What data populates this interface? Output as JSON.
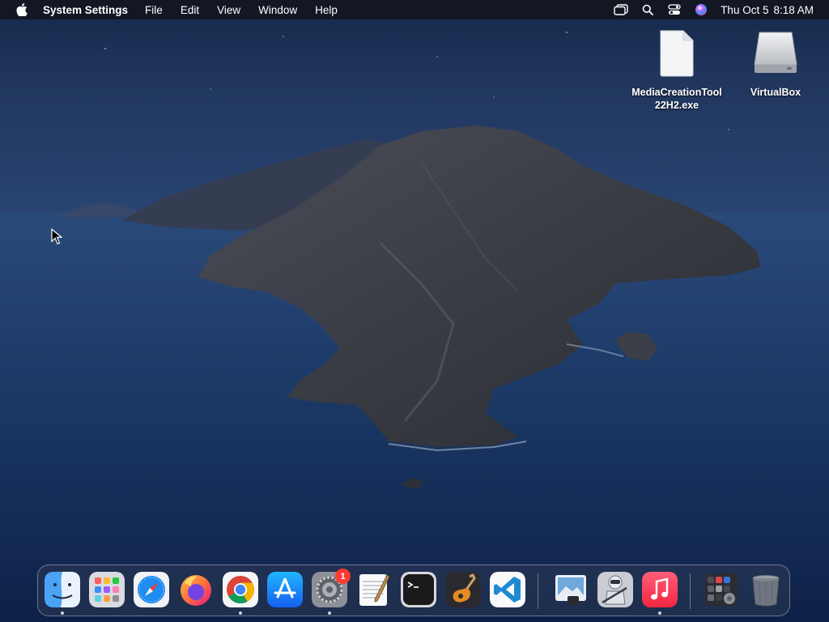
{
  "menubar": {
    "app_name": "System Settings",
    "menus": [
      "File",
      "Edit",
      "View",
      "Window",
      "Help"
    ],
    "status_icons": [
      "window-switcher-icon",
      "spotlight-search-icon",
      "control-center-icon",
      "siri-icon"
    ],
    "clock_day": "Thu Oct 5",
    "clock_time": "8:18 AM"
  },
  "desktop": {
    "icons": [
      {
        "label_line1": "MediaCreationTool",
        "label_line2": "22H2.exe",
        "icon": "document-file-icon"
      },
      {
        "label_line1": "VirtualBox",
        "label_line2": "",
        "icon": "disk-volume-icon"
      }
    ]
  },
  "dock": {
    "apps": [
      {
        "name": "Finder",
        "icon": "finder-icon",
        "running": true
      },
      {
        "name": "Launchpad",
        "icon": "launchpad-icon",
        "running": false
      },
      {
        "name": "Safari",
        "icon": "safari-icon",
        "running": false
      },
      {
        "name": "Firefox",
        "icon": "firefox-icon",
        "running": false
      },
      {
        "name": "Google Chrome",
        "icon": "chrome-icon",
        "running": true
      },
      {
        "name": "App Store",
        "icon": "app-store-icon",
        "running": false
      },
      {
        "name": "System Settings",
        "icon": "system-settings-icon",
        "running": true,
        "badge": "1"
      },
      {
        "name": "TextEdit",
        "icon": "textedit-icon",
        "running": false
      },
      {
        "name": "Terminal",
        "icon": "terminal-icon",
        "running": false
      },
      {
        "name": "GarageBand",
        "icon": "garageband-icon",
        "running": false
      },
      {
        "name": "Visual Studio Code",
        "icon": "vscode-icon",
        "running": false
      },
      {
        "name": "Preview",
        "icon": "preview-icon",
        "running": false
      },
      {
        "name": "Automator",
        "icon": "automator-icon",
        "running": false
      },
      {
        "name": "Music",
        "icon": "music-icon",
        "running": true
      },
      {
        "name": "Applications Stack",
        "icon": "applications-stack-icon",
        "running": false
      },
      {
        "name": "Trash",
        "icon": "trash-icon",
        "running": false
      }
    ]
  },
  "colors": {
    "menubar_bg": "#12161f",
    "badge_red": "#ff3b30",
    "sea": "#1c3a66",
    "sky": "#1d2f52"
  }
}
